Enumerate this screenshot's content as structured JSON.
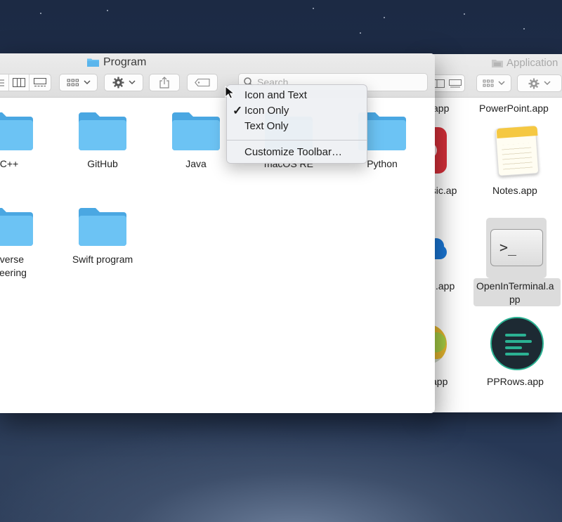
{
  "front_window": {
    "title": "Program",
    "search": {
      "placeholder": "Search"
    },
    "folders": [
      {
        "label": "C++"
      },
      {
        "label": "GitHub"
      },
      {
        "label": "Java"
      },
      {
        "label": "macOS RE"
      },
      {
        "label": "Python"
      },
      {
        "label": "everse"
      },
      {
        "label": "ineering"
      },
      {
        "label": "Swift program"
      }
    ]
  },
  "back_window": {
    "title": "Application",
    "apps": [
      {
        "label": "app"
      },
      {
        "label": "PowerPoint.app"
      },
      {
        "label": "usic.ap"
      },
      {
        "label": "Notes.app"
      },
      {
        "label": ".app"
      },
      {
        "label": "OpenInTerminal.a"
      },
      {
        "label": "pp"
      },
      {
        "label": "app"
      },
      {
        "label": "PPRows.app"
      }
    ]
  },
  "context_menu": {
    "items": [
      {
        "label": "Icon and Text",
        "checked": false
      },
      {
        "label": "Icon Only",
        "checked": true,
        "check_glyph": "✓"
      },
      {
        "label": "Text Only",
        "checked": false
      },
      {
        "label": "Customize Toolbar…",
        "checked": false
      }
    ]
  },
  "colors": {
    "folder_blue": "#6cc3f4",
    "folder_blue_dark": "#4aa7e2",
    "menu_bg": "#eef0f4",
    "desktop": "#1f2d45"
  }
}
